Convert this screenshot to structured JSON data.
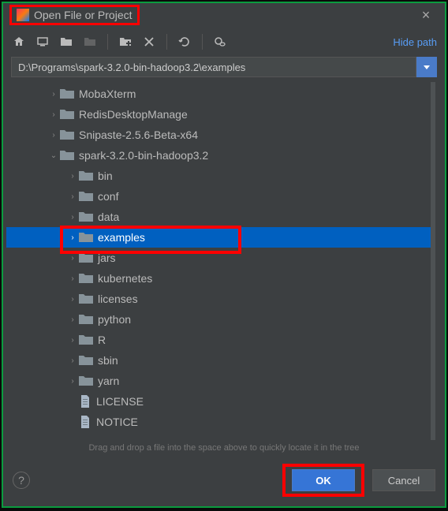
{
  "title": "Open File or Project",
  "toolbar": {
    "hide_path": "Hide path"
  },
  "path": "D:\\Programs\\spark-3.2.0-bin-hadoop3.2\\examples",
  "tree": [
    {
      "indent": 1,
      "kind": "folder",
      "chev": "right",
      "label": "MobaXterm"
    },
    {
      "indent": 1,
      "kind": "folder",
      "chev": "right",
      "label": "RedisDesktopManage"
    },
    {
      "indent": 1,
      "kind": "folder",
      "chev": "right",
      "label": "Snipaste-2.5.6-Beta-x64"
    },
    {
      "indent": 1,
      "kind": "folder",
      "chev": "down",
      "label": "spark-3.2.0-bin-hadoop3.2"
    },
    {
      "indent": 2,
      "kind": "folder",
      "chev": "right",
      "label": "bin"
    },
    {
      "indent": 2,
      "kind": "folder",
      "chev": "right",
      "label": "conf"
    },
    {
      "indent": 2,
      "kind": "folder",
      "chev": "right",
      "label": "data"
    },
    {
      "indent": 2,
      "kind": "folder",
      "chev": "right",
      "label": "examples",
      "selected": true,
      "highlight": true
    },
    {
      "indent": 2,
      "kind": "folder",
      "chev": "right",
      "label": "jars"
    },
    {
      "indent": 2,
      "kind": "folder",
      "chev": "right",
      "label": "kubernetes"
    },
    {
      "indent": 2,
      "kind": "folder",
      "chev": "right",
      "label": "licenses"
    },
    {
      "indent": 2,
      "kind": "folder",
      "chev": "right",
      "label": "python"
    },
    {
      "indent": 2,
      "kind": "folder",
      "chev": "right",
      "label": "R"
    },
    {
      "indent": 2,
      "kind": "folder",
      "chev": "right",
      "label": "sbin"
    },
    {
      "indent": 2,
      "kind": "folder",
      "chev": "right",
      "label": "yarn"
    },
    {
      "indent": 2,
      "kind": "file",
      "chev": "",
      "label": "LICENSE"
    },
    {
      "indent": 2,
      "kind": "file",
      "chev": "",
      "label": "NOTICE"
    }
  ],
  "hint": "Drag and drop a file into the space above to quickly locate it in the tree",
  "buttons": {
    "ok": "OK",
    "cancel": "Cancel"
  }
}
